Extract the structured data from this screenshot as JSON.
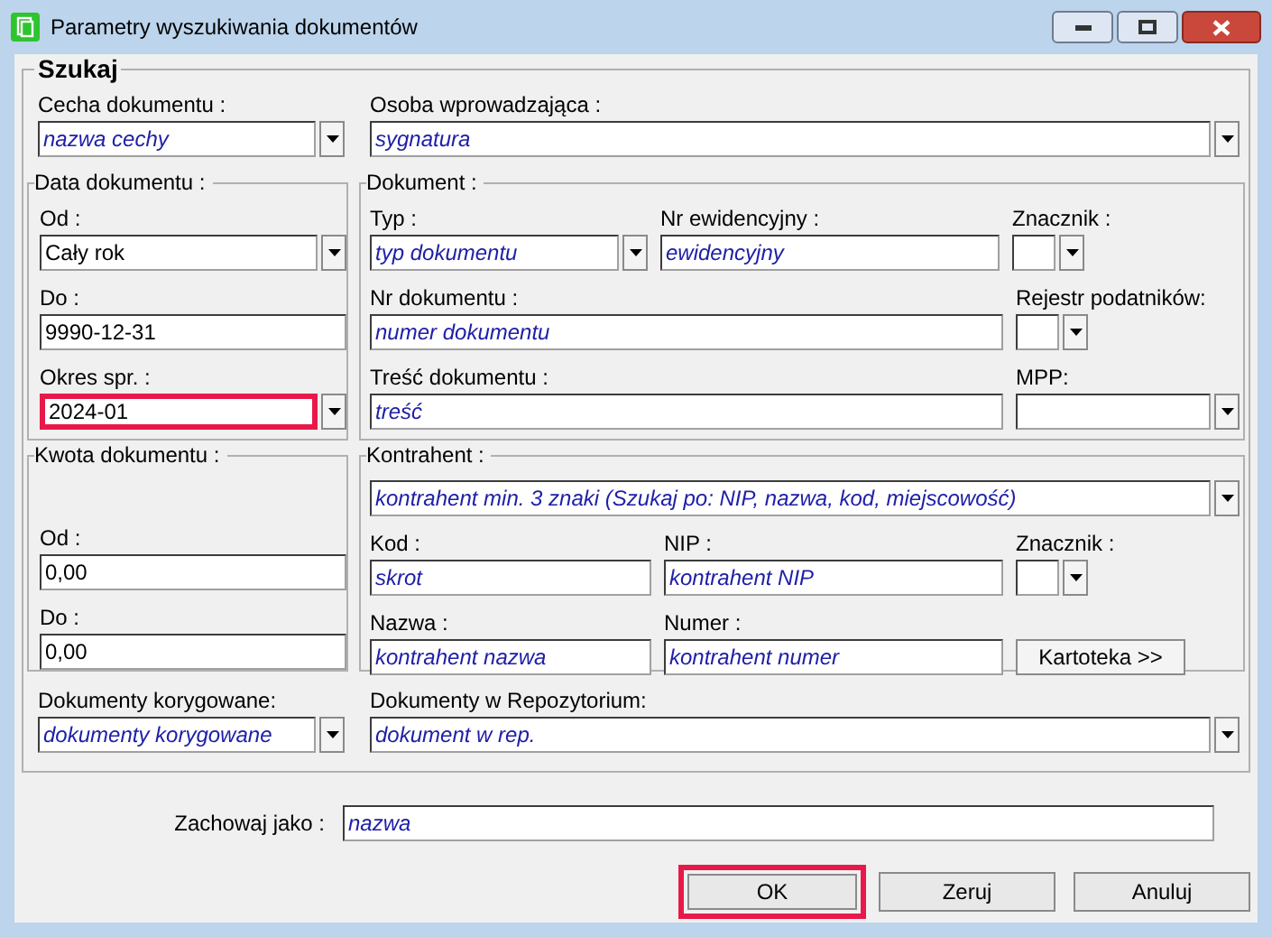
{
  "window": {
    "title": "Parametry wyszukiwania dokumentów"
  },
  "search": {
    "title": "Szukaj",
    "cecha": {
      "label": "Cecha dokumentu :",
      "placeholder": "nazwa cechy"
    },
    "osoba": {
      "label": "Osoba wprowadzająca :",
      "placeholder": "sygnatura"
    },
    "data_dokumentu": {
      "title": "Data dokumentu :",
      "od": {
        "label": "Od :",
        "value": "Cały rok"
      },
      "do": {
        "label": "Do :",
        "value": "9990-12-31"
      },
      "okres": {
        "label": "Okres spr. :",
        "value": "2024-01",
        "highlighted": true
      }
    },
    "dokument": {
      "title": "Dokument :",
      "typ": {
        "label": "Typ :",
        "placeholder": "typ dokumentu"
      },
      "nr_ewidencyjny": {
        "label": "Nr ewidencyjny :",
        "placeholder": "ewidencyjny"
      },
      "znacznik": {
        "label": "Znacznik :"
      },
      "nr_dokumentu": {
        "label": "Nr dokumentu :",
        "placeholder": "numer dokumentu"
      },
      "rejestr": {
        "label": "Rejestr podatników:"
      },
      "tresc": {
        "label": "Treść dokumentu :",
        "placeholder": "treść"
      },
      "mpp": {
        "label": "MPP:"
      }
    },
    "kwota": {
      "title": "Kwota dokumentu :",
      "od": {
        "label": "Od :",
        "value": "0,00"
      },
      "do": {
        "label": "Do :",
        "value": "0,00"
      }
    },
    "kontrahent": {
      "title": "Kontrahent :",
      "szukaj": {
        "placeholder": "kontrahent min. 3 znaki (Szukaj po: NIP, nazwa, kod, miejscowość)"
      },
      "kod": {
        "label": "Kod :",
        "placeholder": "skrot"
      },
      "nip": {
        "label": "NIP :",
        "placeholder": "kontrahent NIP"
      },
      "znacznik": {
        "label": "Znacznik :"
      },
      "nazwa": {
        "label": "Nazwa :",
        "placeholder": "kontrahent nazwa"
      },
      "numer": {
        "label": "Numer :",
        "placeholder": "kontrahent numer"
      },
      "kartoteka": {
        "label": "Kartoteka >>"
      }
    },
    "korygowane": {
      "label": "Dokumenty korygowane:",
      "placeholder": "dokumenty korygowane"
    },
    "repozytorium": {
      "label": "Dokumenty w Repozytorium:",
      "placeholder": "dokument w rep."
    }
  },
  "save_as": {
    "label": "Zachowaj jako :",
    "placeholder": "nazwa"
  },
  "buttons": [
    {
      "label": "OK",
      "highlighted": true
    },
    {
      "label": "Zeruj",
      "highlighted": false
    },
    {
      "label": "Anuluj",
      "highlighted": false
    }
  ]
}
